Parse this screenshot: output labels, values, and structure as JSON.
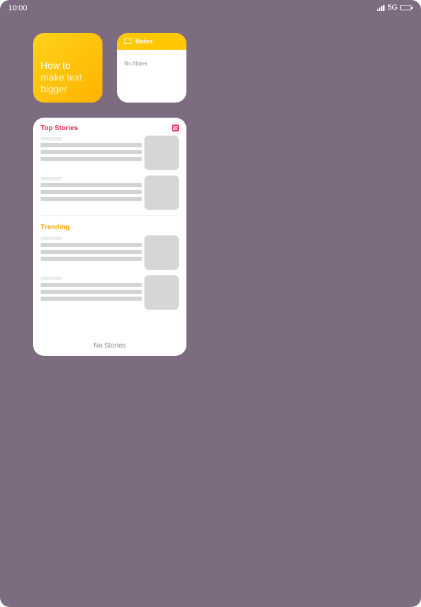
{
  "status_bar": {
    "time": "10:00",
    "network": "5G",
    "battery_level": 1.0
  },
  "tips_widget": {
    "lines": [
      "How to",
      "make text",
      "bigger"
    ],
    "gradient": [
      "#ffd21a",
      "#ffb300"
    ]
  },
  "notes_widget": {
    "title": "Notes",
    "empty_text": "No Notes",
    "accent": "#ffc800"
  },
  "news_widget": {
    "top_stories_title": "Top Stories",
    "top_stories_color": "#e0254c",
    "trending_title": "Trending",
    "trending_color": "#f0a000",
    "empty_text": "No Stories",
    "brand_color": "#f0355a"
  },
  "wallpaper_color": "#7d6b80"
}
